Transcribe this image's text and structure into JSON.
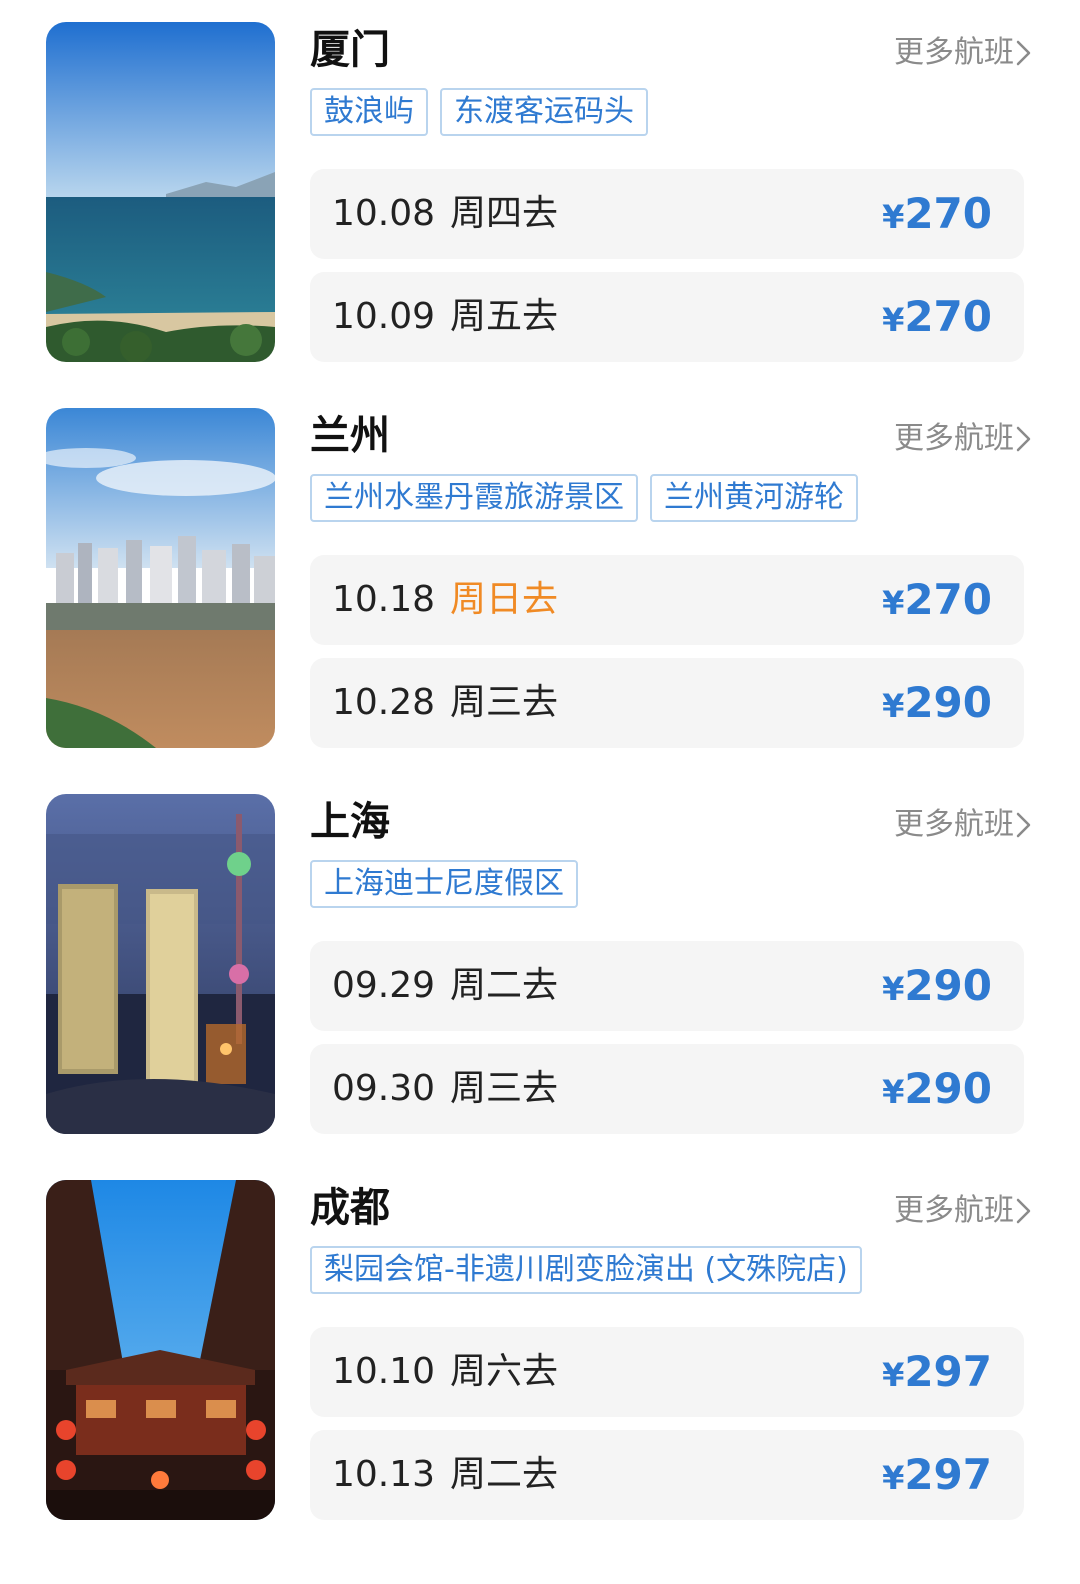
{
  "colors": {
    "accent_blue": "#2f7ad1",
    "weekend_orange": "#f08a24",
    "row_background": "#f5f5f5",
    "tag_border": "#b9d4ee",
    "muted_text": "#8a8a8a"
  },
  "more_label": "更多航班",
  "currency_symbol": "¥",
  "destinations": [
    {
      "city": "厦门",
      "image": "xiamen-coastline-photo",
      "tags": [
        "鼓浪屿",
        "东渡客运码头"
      ],
      "flights": [
        {
          "date": "10.08",
          "weekday": "周四去",
          "price": "270"
        },
        {
          "date": "10.09",
          "weekday": "周五去",
          "price": "270"
        }
      ]
    },
    {
      "city": "兰州",
      "image": "lanzhou-yellow-river-city-photo",
      "tags": [
        "兰州水墨丹霞旅游景区",
        "兰州黄河游轮"
      ],
      "flights": [
        {
          "date": "10.18",
          "weekday": "周日去",
          "price": "270",
          "weekend": true
        },
        {
          "date": "10.28",
          "weekday": "周三去",
          "price": "290"
        }
      ]
    },
    {
      "city": "上海",
      "image": "shanghai-lujiazui-night-photo",
      "tags": [
        "上海迪士尼度假区"
      ],
      "flights": [
        {
          "date": "09.29",
          "weekday": "周二去",
          "price": "290"
        },
        {
          "date": "09.30",
          "weekday": "周三去",
          "price": "290"
        }
      ]
    },
    {
      "city": "成都",
      "image": "chengdu-traditional-street-photo",
      "tags": [
        "梨园会馆-非遗川剧变脸演出 (文殊院店)"
      ],
      "flights": [
        {
          "date": "10.10",
          "weekday": "周六去",
          "price": "297"
        },
        {
          "date": "10.13",
          "weekday": "周二去",
          "price": "297"
        }
      ]
    }
  ]
}
